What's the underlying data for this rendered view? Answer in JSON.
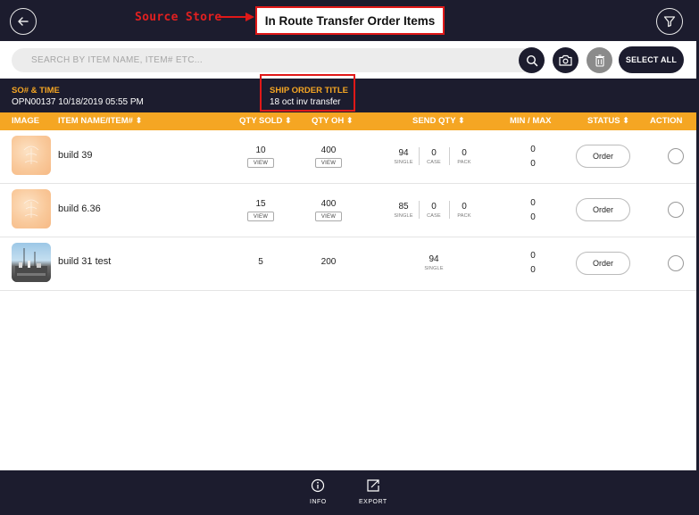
{
  "header": {
    "title": "In Route Transfer Order Items",
    "annotation_label": "Source Store"
  },
  "search": {
    "placeholder": "SEARCH BY ITEM NAME, ITEM# ETC..."
  },
  "toolbar": {
    "select_all_label": "SELECT ALL"
  },
  "order_info": {
    "so_label": "SO# & TIME",
    "so_value": "OPN00137  10/18/2019 05:55 PM",
    "ship_title_label": "SHIP ORDER TITLE",
    "ship_title_value": "18 oct inv transfer"
  },
  "columns": {
    "image": "IMAGE",
    "item_name": "ITEM NAME/ITEM#",
    "qty_sold": "QTY SOLD",
    "qty_oh": "QTY OH",
    "send_qty": "SEND QTY",
    "min_max": "MIN / MAX",
    "status": "STATUS",
    "action": "ACTION",
    "sort_glyph": "⬍"
  },
  "labels": {
    "view": "VIEW",
    "single": "SINGLE",
    "case": "CASE",
    "pack": "PACK"
  },
  "rows": [
    {
      "name": "build 39",
      "qty_sold": "10",
      "qty_oh": "400",
      "send_single": "94",
      "send_case": "0",
      "send_pack": "0",
      "min": "0",
      "max": "0",
      "status": "Order"
    },
    {
      "name": "build 6.36",
      "qty_sold": "15",
      "qty_oh": "400",
      "send_single": "85",
      "send_case": "0",
      "send_pack": "0",
      "min": "0",
      "max": "0",
      "status": "Order"
    },
    {
      "name": "build 31 test",
      "qty_sold": "5",
      "qty_oh": "200",
      "send_single": "94",
      "min": "0",
      "max": "0",
      "status": "Order"
    }
  ],
  "footer": {
    "info_label": "INFO",
    "export_label": "EXPORT"
  },
  "colors": {
    "header_bg": "#1c1c2e",
    "accent": "#f5a623",
    "annotation_red": "#e01818"
  },
  "icons": [
    "back-arrow-icon",
    "filter-icon",
    "search-icon",
    "camera-icon",
    "trash-icon",
    "info-icon",
    "export-icon",
    "product-image-icon"
  ]
}
